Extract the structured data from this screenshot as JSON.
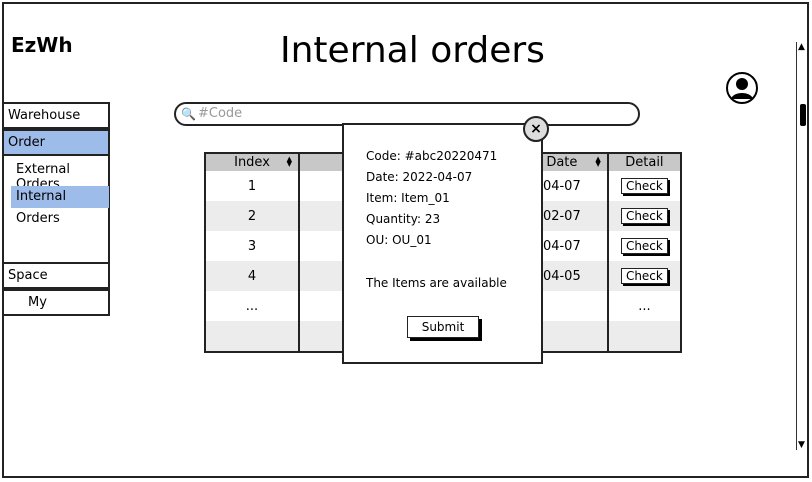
{
  "app": {
    "logo": "EzWh",
    "title": "Internal orders"
  },
  "sidebar": {
    "items": [
      {
        "label": "Warehouse"
      },
      {
        "label": "Order"
      },
      {
        "label": "External Orders"
      },
      {
        "label": "Internal Orders"
      },
      {
        "label": "Space"
      },
      {
        "label": "My"
      }
    ]
  },
  "search": {
    "placeholder": "#Code"
  },
  "table": {
    "headers": [
      "Index",
      "",
      "",
      "Date",
      "Detail"
    ],
    "rows": [
      {
        "index": "1",
        "c2": "#",
        "c3": "",
        "date": "04-07",
        "action": "Check"
      },
      {
        "index": "2",
        "c2": "#",
        "c3": "",
        "date": "02-07",
        "action": "Check"
      },
      {
        "index": "3",
        "c2": "#",
        "c3": "",
        "date": "04-07",
        "action": "Check"
      },
      {
        "index": "4",
        "c2": "#",
        "c3": "",
        "date": "04-05",
        "action": "Check"
      },
      {
        "index": "...",
        "c2": "",
        "c3": "",
        "date": "",
        "action": "..."
      },
      {
        "index": "",
        "c2": "",
        "c3": "",
        "date": "",
        "action": ""
      }
    ]
  },
  "modal": {
    "code": "Code: #abc20220471",
    "date": "Date: 2022-04-07",
    "item": "Item: Item_01",
    "quantity": "Quantity: 23",
    "ou": "OU: OU_01",
    "status": "The Items are available",
    "submit_label": "Submit",
    "close_symbol": "×"
  },
  "icons": {
    "search": "search-icon",
    "avatar": "user-avatar-icon",
    "close": "close-icon"
  }
}
